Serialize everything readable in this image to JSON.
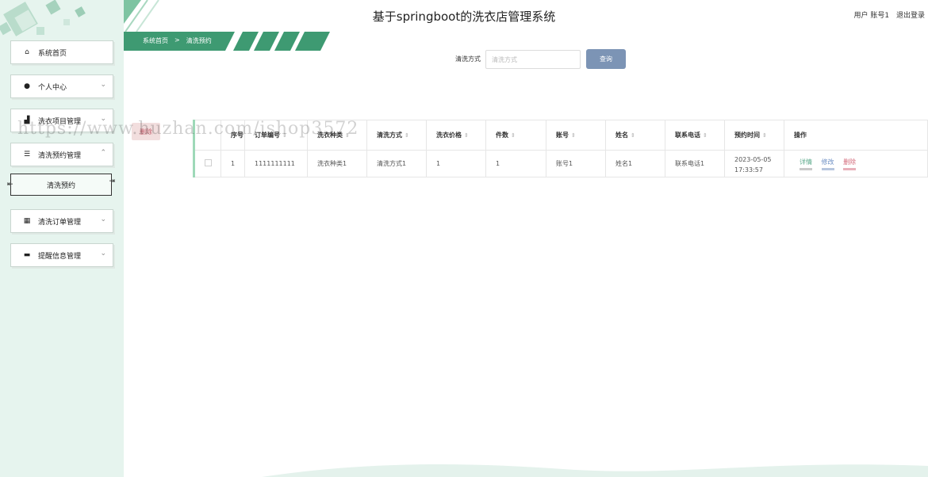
{
  "app": {
    "title": "基于springboot的洗衣店管理系统",
    "user_label": "用户 账号1",
    "logout_label": "退出登录"
  },
  "sidebar": {
    "items": [
      {
        "label": "系统首页",
        "icon": "home-icon",
        "has_chevron": false
      },
      {
        "label": "个人中心",
        "icon": "user-icon",
        "has_chevron": true
      },
      {
        "label": "洗衣项目管理",
        "icon": "shirt-icon",
        "has_chevron": true
      },
      {
        "label": "清洗预约管理",
        "icon": "sliders-icon",
        "has_chevron": true,
        "expanded": true
      },
      {
        "label": "清洗订单管理",
        "icon": "grid-icon",
        "has_chevron": true
      },
      {
        "label": "提醒信息管理",
        "icon": "message-icon",
        "has_chevron": true
      }
    ],
    "submenu": {
      "label": "清洗预约"
    }
  },
  "breadcrumb": {
    "home": "系统首页",
    "separator": ">",
    "current": "清洗预约"
  },
  "search": {
    "label": "清洗方式",
    "placeholder": "清洗方式",
    "button": "查询"
  },
  "toolbar": {
    "delete_label": "删除"
  },
  "table": {
    "columns": [
      "",
      "序号",
      "订单编号",
      "洗衣种类",
      "清洗方式",
      "洗衣价格",
      "件数",
      "账号",
      "姓名",
      "联系电话",
      "预约时间",
      "操作"
    ],
    "rows": [
      {
        "index": "1",
        "order_no": "1111111111",
        "laundry_type": "洗衣种类1",
        "wash_method": "清洗方式1",
        "price": "1",
        "count": "1",
        "account": "账号1",
        "name": "姓名1",
        "phone": "联系电话1",
        "date": "2023-05-05",
        "time": "17:33:57"
      }
    ],
    "actions": {
      "detail": "详情",
      "edit": "修改",
      "delete": "删除"
    }
  },
  "watermark": "https://www.huzhan.com/ishop3572",
  "colors": {
    "accent": "#5aa88a",
    "sidebar_bg": "#e6f4ee",
    "query_button": "#7c94b5",
    "delete_text": "#d36b7b"
  }
}
